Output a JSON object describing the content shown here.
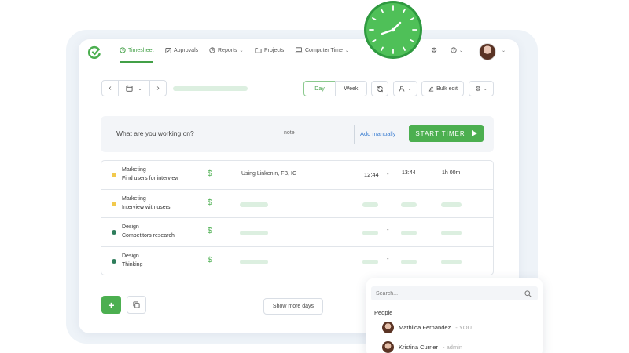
{
  "nav": {
    "items": [
      {
        "label": "Timesheet",
        "icon": "clock-icon",
        "active": true
      },
      {
        "label": "Approvals",
        "icon": "calendar-check-icon"
      },
      {
        "label": "Reports",
        "icon": "chart-icon",
        "dropdown": true
      },
      {
        "label": "Projects",
        "icon": "folder-icon"
      },
      {
        "label": "Computer Time",
        "icon": "monitor-icon",
        "dropdown": true
      }
    ]
  },
  "toolbar": {
    "day_label": "Day",
    "week_label": "Week",
    "bulk_edit_label": "Bulk edit"
  },
  "timer": {
    "placeholder": "What are you working on?",
    "note": "note",
    "add_manually": "Add manually",
    "start_label": "START TIMER"
  },
  "entries": [
    {
      "project": "Marketing",
      "task": "Find users for interview",
      "dot_color": "#f2c94c",
      "billable": "$",
      "description": "Using LinkenIn, FB, IG",
      "start": "12:44",
      "dash": "-",
      "end": "13:44",
      "duration": "1h 00m"
    },
    {
      "project": "Marketing",
      "task": "Interview with users",
      "dot_color": "#f2c94c",
      "billable": "$"
    },
    {
      "project": "Design",
      "task": "Competitors research",
      "dot_color": "#2e7d5b",
      "billable": "$",
      "dash": "-"
    },
    {
      "project": "Design",
      "task": "Thinking",
      "dot_color": "#2e7d5b",
      "billable": "$",
      "dash": "-"
    }
  ],
  "bottom": {
    "add_symbol": "+",
    "show_more_label": "Show more days"
  },
  "search_panel": {
    "placeholder": "Search...",
    "section_label": "People",
    "people": [
      {
        "name": "Mathilda Fernandez",
        "role": "- YOU"
      },
      {
        "name": "Kristina Currier",
        "role": "- admin"
      }
    ]
  },
  "colors": {
    "accent": "#4caf50",
    "link": "#3d7fd1",
    "skeleton": "#dcefe0"
  }
}
